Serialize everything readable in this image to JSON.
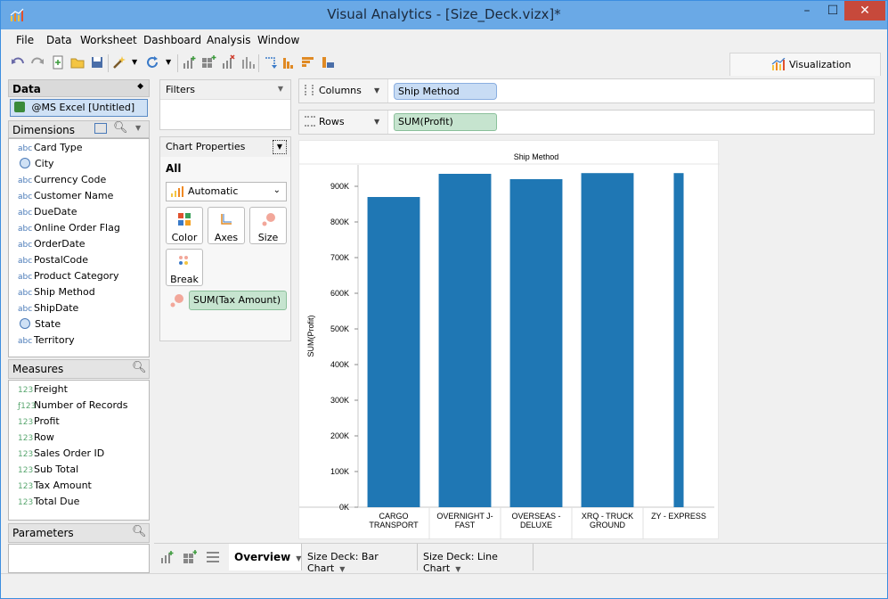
{
  "window": {
    "title": "Visual Analytics - [Size_Deck.vizx]*"
  },
  "menu": [
    "File",
    "Data",
    "Worksheet",
    "Dashboard",
    "Analysis",
    "Window"
  ],
  "toolbar": {
    "visualization_tab": "Visualization"
  },
  "data_pane": {
    "header": "Data",
    "datasource": "@MS Excel [Untitled]",
    "dimensions_header": "Dimensions",
    "dimensions": [
      {
        "type": "abc",
        "label": "Card Type"
      },
      {
        "type": "geo",
        "label": "City"
      },
      {
        "type": "abc",
        "label": "Currency Code"
      },
      {
        "type": "abc",
        "label": "Customer Name"
      },
      {
        "type": "abc",
        "label": "DueDate"
      },
      {
        "type": "abc",
        "label": "Online Order Flag"
      },
      {
        "type": "abc",
        "label": "OrderDate"
      },
      {
        "type": "abc",
        "label": "PostalCode"
      },
      {
        "type": "abc",
        "label": "Product Category"
      },
      {
        "type": "abc",
        "label": "Ship Method"
      },
      {
        "type": "abc",
        "label": "ShipDate"
      },
      {
        "type": "geo",
        "label": "State"
      },
      {
        "type": "abc",
        "label": "Territory"
      }
    ],
    "measures_header": "Measures",
    "measures": [
      {
        "type": "123",
        "label": "Freight"
      },
      {
        "type": "f123",
        "label": "Number of Records"
      },
      {
        "type": "123",
        "label": "Profit"
      },
      {
        "type": "123",
        "label": "Row"
      },
      {
        "type": "123",
        "label": "Sales Order ID"
      },
      {
        "type": "123",
        "label": "Sub Total"
      },
      {
        "type": "123",
        "label": "Tax Amount"
      },
      {
        "type": "123",
        "label": "Total Due"
      }
    ],
    "parameters_header": "Parameters"
  },
  "filters": {
    "header": "Filters"
  },
  "chart_properties": {
    "header": "Chart Properties",
    "scope": "All",
    "mark_type": "Automatic",
    "buttons": {
      "color": "Color",
      "axes": "Axes",
      "size": "Size",
      "break": "Break"
    },
    "size_pill": "SUM(Tax Amount)"
  },
  "shelves": {
    "columns_label": "Columns",
    "columns_pill": "Ship Method",
    "rows_label": "Rows",
    "rows_pill": "SUM(Profit)"
  },
  "sheets": [
    "Overview",
    "Size Deck: Bar Chart",
    "Size Deck: Line Chart"
  ],
  "chart_data": {
    "type": "bar",
    "title": "Ship Method",
    "xlabel": "",
    "ylabel": "SUM(Profit)",
    "categories": [
      "CARGO TRANSPORT",
      "OVERNIGHT J-FAST",
      "OVERSEAS - DELUXE",
      "XRQ - TRUCK GROUND",
      "ZY - EXPRESS"
    ],
    "category_lines": [
      [
        "CARGO",
        "TRANSPORT"
      ],
      [
        "OVERNIGHT J-",
        "FAST"
      ],
      [
        "OVERSEAS -",
        "DELUXE"
      ],
      [
        "XRQ - TRUCK",
        "GROUND"
      ],
      [
        "ZY - EXPRESS"
      ]
    ],
    "values": [
      870000,
      935000,
      920000,
      937000,
      937000
    ],
    "size_fraction": [
      0.8,
      0.8,
      0.8,
      0.8,
      0.15
    ],
    "ylim": [
      0,
      960000
    ],
    "yticks": [
      0,
      100000,
      200000,
      300000,
      400000,
      500000,
      600000,
      700000,
      800000,
      900000
    ],
    "ytick_labels": [
      "0K",
      "100K",
      "200K",
      "300K",
      "400K",
      "500K",
      "600K",
      "700K",
      "800K",
      "900K"
    ],
    "bar_color": "#1f77b4",
    "grid": false
  }
}
